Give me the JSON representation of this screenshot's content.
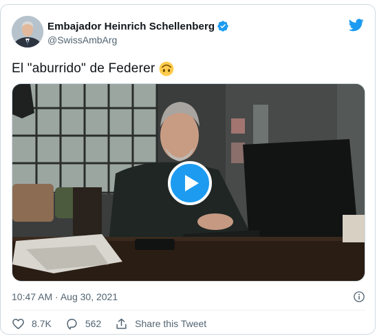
{
  "author": {
    "display_name": "Embajador Heinrich Schellenberg",
    "handle": "@SwissAmbArg",
    "avatar_icon": "profile-photo",
    "verified_icon": "verified-badge-icon"
  },
  "brand": {
    "icon": "twitter-bird-icon",
    "color": "#1d9bf0"
  },
  "tweet": {
    "text": "El \"aburrido\" de Federer",
    "emoji": "upside-down-face"
  },
  "media": {
    "type": "video",
    "play_icon": "play-icon"
  },
  "meta": {
    "timestamp": "10:47 AM · Aug 30, 2021",
    "info_icon": "info-icon"
  },
  "actions": {
    "like_count": "8.7K",
    "reply_count": "562",
    "share_label": "Share this Tweet"
  },
  "colors": {
    "text_primary": "#0f1419",
    "text_secondary": "#536471",
    "accent": "#1d9bf0",
    "border": "#cfd9de"
  }
}
